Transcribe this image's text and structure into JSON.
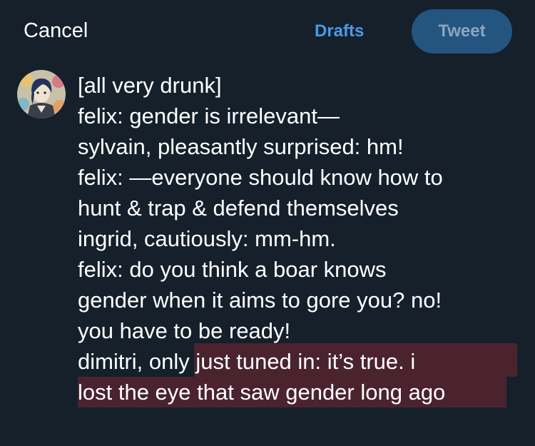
{
  "header": {
    "cancel_label": "Cancel",
    "drafts_label": "Drafts",
    "tweet_label": "Tweet"
  },
  "avatar": {
    "icon": "user-avatar"
  },
  "compose": {
    "lines": [
      "[all very drunk]",
      "felix: gender is irrelevant—",
      "sylvain, pleasantly surprised: hm!",
      "felix: —everyone should know how to",
      "hunt & trap & defend themselves",
      "ingrid, cautiously: mm-hm.",
      "felix: do you think a boar knows",
      "gender when it aims to gore you? no!",
      "you have to be ready!",
      "dimitri, only just tuned in: it’s true. i",
      "lost the eye that saw gender long ago"
    ]
  },
  "colors": {
    "background": "#15202b",
    "accent": "#4a99e9",
    "tweet_button_disabled": "#245480",
    "selection_highlight": "#4a232f"
  }
}
